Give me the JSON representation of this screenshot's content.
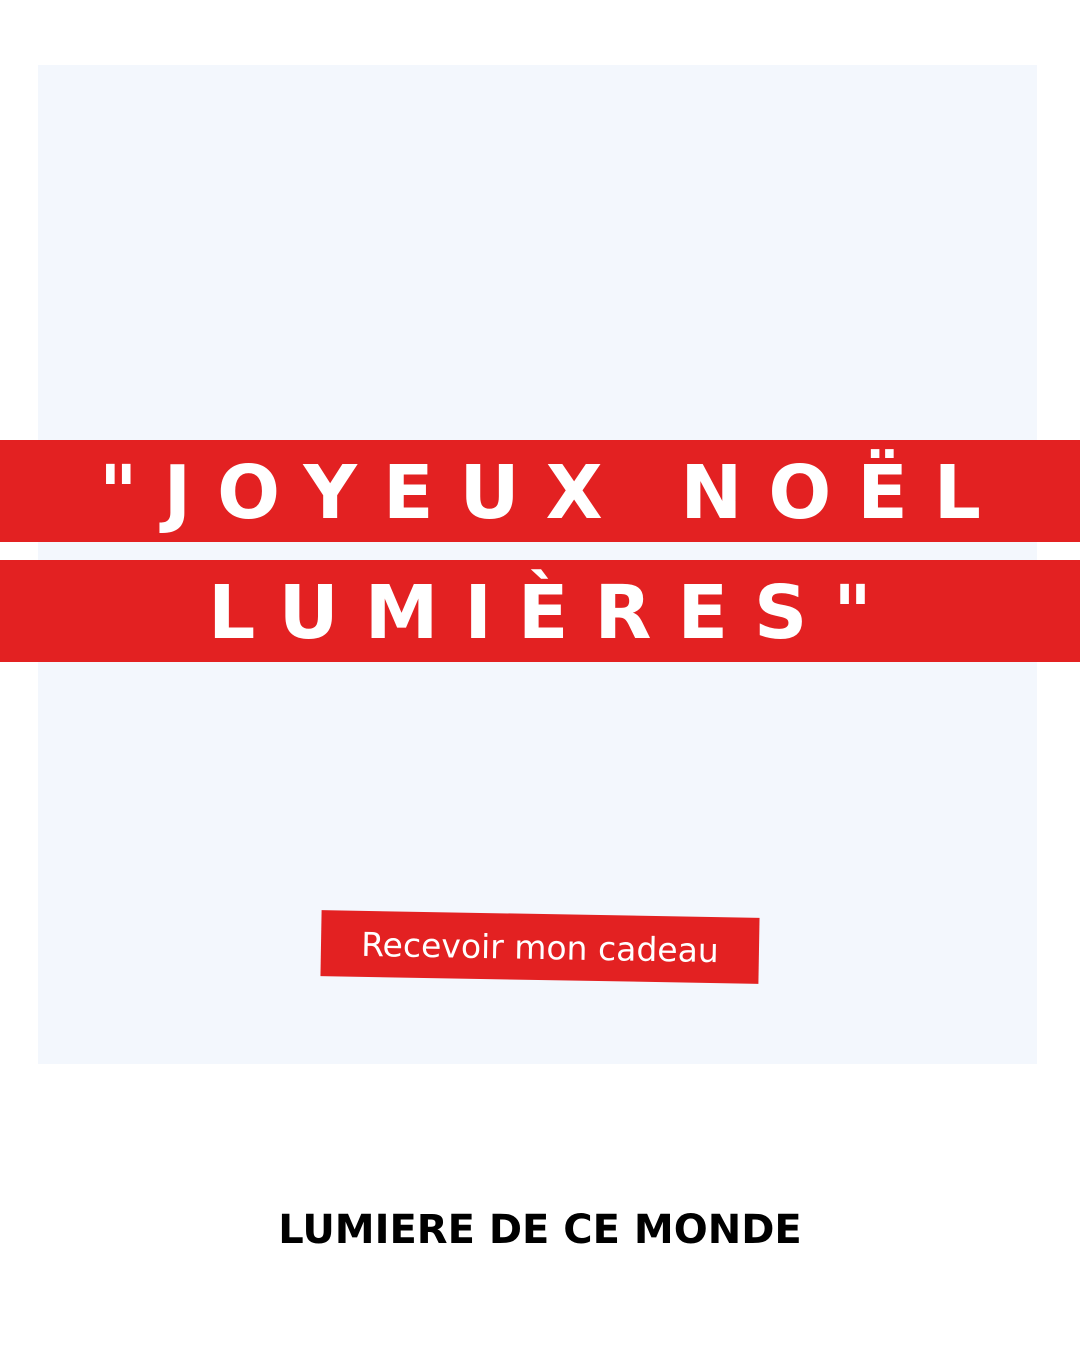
{
  "headline": {
    "line1": "\"JOYEUX NOËL",
    "line2": "LUMIÈRES\""
  },
  "cta": {
    "label": "Recevoir mon cadeau"
  },
  "footer": {
    "brand": "LUMIERE DE CE MONDE"
  },
  "colors": {
    "accent": "#e32122",
    "panel": "#f3f7fd",
    "background": "#ffffff",
    "text_light": "#ffffff",
    "text_dark": "#000000"
  }
}
